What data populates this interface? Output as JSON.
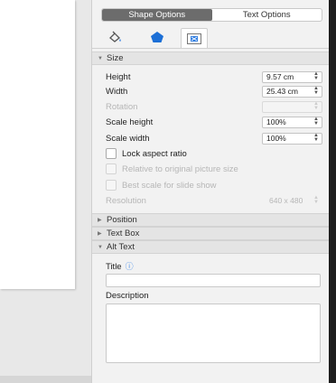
{
  "tabs": {
    "shape_options": "Shape Options",
    "text_options": "Text Options"
  },
  "icon_tabs": [
    {
      "name": "fill-line-icon"
    },
    {
      "name": "effects-icon"
    },
    {
      "name": "size-properties-icon"
    }
  ],
  "size_section": {
    "header": "Size",
    "height": {
      "label": "Height",
      "value": "9.57 cm"
    },
    "width": {
      "label": "Width",
      "value": "25.43 cm"
    },
    "rotation": {
      "label": "Rotation",
      "value": ""
    },
    "scale_height": {
      "label": "Scale height",
      "value": "100%"
    },
    "scale_width": {
      "label": "Scale width",
      "value": "100%"
    },
    "lock_aspect": "Lock aspect ratio",
    "relative_original": "Relative to original picture size",
    "best_scale": "Best scale for slide show",
    "resolution": {
      "label": "Resolution",
      "value": "640 x 480"
    }
  },
  "collapsed_sections": {
    "position": "Position",
    "text_box": "Text Box"
  },
  "alt_text_section": {
    "header": "Alt Text",
    "title_label": "Title",
    "title_value": "",
    "description_label": "Description",
    "description_value": ""
  },
  "colors": {
    "accent": "#3a86e8",
    "active_tab": "#6c6c6c"
  }
}
